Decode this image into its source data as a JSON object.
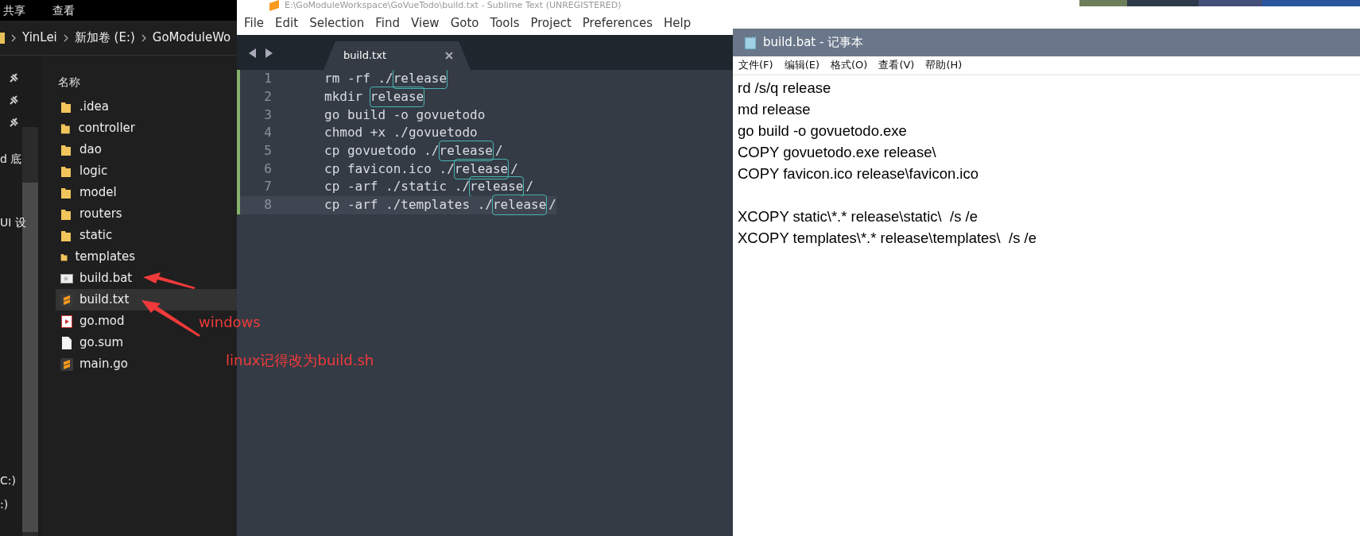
{
  "explorer": {
    "ribbon_tabs": [
      "共享",
      "查看"
    ],
    "breadcrumb": [
      "YinLei",
      "新加卷 (E:)",
      "GoModuleWo"
    ],
    "nav_fragments": [
      "d 底",
      "UI 设",
      "C:)",
      ":)"
    ],
    "column_header": "名称",
    "files": [
      {
        "name": ".idea",
        "kind": "folder",
        "selected": false
      },
      {
        "name": "controller",
        "kind": "folder",
        "selected": false
      },
      {
        "name": "dao",
        "kind": "folder",
        "selected": false
      },
      {
        "name": "logic",
        "kind": "folder",
        "selected": false
      },
      {
        "name": "model",
        "kind": "folder",
        "selected": false
      },
      {
        "name": "routers",
        "kind": "folder",
        "selected": false
      },
      {
        "name": "static",
        "kind": "folder",
        "selected": false
      },
      {
        "name": "templates",
        "kind": "folder",
        "selected": false
      },
      {
        "name": "build.bat",
        "kind": "batch",
        "selected": false
      },
      {
        "name": "build.txt",
        "kind": "sublime",
        "selected": true
      },
      {
        "name": "go.mod",
        "kind": "media",
        "selected": false
      },
      {
        "name": "go.sum",
        "kind": "blank",
        "selected": false
      },
      {
        "name": "main.go",
        "kind": "sublime",
        "selected": false
      }
    ]
  },
  "sublime": {
    "title": "E:\\GoModuleWorkspace\\GoVueTodo\\build.txt - Sublime Text (UNREGISTERED)",
    "menu": [
      "File",
      "Edit",
      "Selection",
      "Find",
      "View",
      "Goto",
      "Tools",
      "Project",
      "Preferences",
      "Help"
    ],
    "tab": {
      "label": "build.txt"
    },
    "lines": [
      {
        "number": "1",
        "current": false,
        "parts": [
          {
            "text": "rm -rf ./",
            "boxed": false
          },
          {
            "text": "release",
            "boxed": true
          }
        ]
      },
      {
        "number": "2",
        "current": false,
        "parts": [
          {
            "text": "mkdir ",
            "boxed": false
          },
          {
            "text": "release",
            "boxed": true
          }
        ]
      },
      {
        "number": "3",
        "current": false,
        "parts": [
          {
            "text": "go build -o govuetodo",
            "boxed": false
          }
        ]
      },
      {
        "number": "4",
        "current": false,
        "parts": [
          {
            "text": "chmod +x ./govuetodo",
            "boxed": false
          }
        ]
      },
      {
        "number": "5",
        "current": false,
        "parts": [
          {
            "text": "cp govuetodo ./",
            "boxed": false
          },
          {
            "text": "release",
            "boxed": true
          },
          {
            "text": "/",
            "boxed": false
          }
        ]
      },
      {
        "number": "6",
        "current": false,
        "parts": [
          {
            "text": "cp favicon.ico ./",
            "boxed": false
          },
          {
            "text": "release",
            "boxed": true
          },
          {
            "text": "/",
            "boxed": false
          }
        ]
      },
      {
        "number": "7",
        "current": false,
        "parts": [
          {
            "text": "cp -arf ./static ./",
            "boxed": false
          },
          {
            "text": "release",
            "boxed": true
          },
          {
            "text": "/",
            "boxed": false
          }
        ]
      },
      {
        "number": "8",
        "current": true,
        "parts": [
          {
            "text": "cp -arf ./templates ./",
            "boxed": false
          },
          {
            "text": "release",
            "boxed": true
          },
          {
            "text": "/",
            "boxed": false
          }
        ]
      }
    ]
  },
  "notepad": {
    "title": "build.bat - 记事本",
    "menu": [
      "文件(F)",
      "编辑(E)",
      "格式(O)",
      "查看(V)",
      "帮助(H)"
    ],
    "blocks": [
      [
        "rd /s/q release",
        "md release",
        "go build -o govuetodo.exe",
        "COPY govuetodo.exe release\\",
        "COPY favicon.ico release\\favicon.ico"
      ],
      [
        "XCOPY static\\*.* release\\static\\  /s /e",
        "XCOPY templates\\*.* release\\templates\\  /s /e"
      ]
    ]
  },
  "annotations": [
    {
      "text": "windows"
    },
    {
      "text": "linux记得改为build.sh"
    }
  ]
}
